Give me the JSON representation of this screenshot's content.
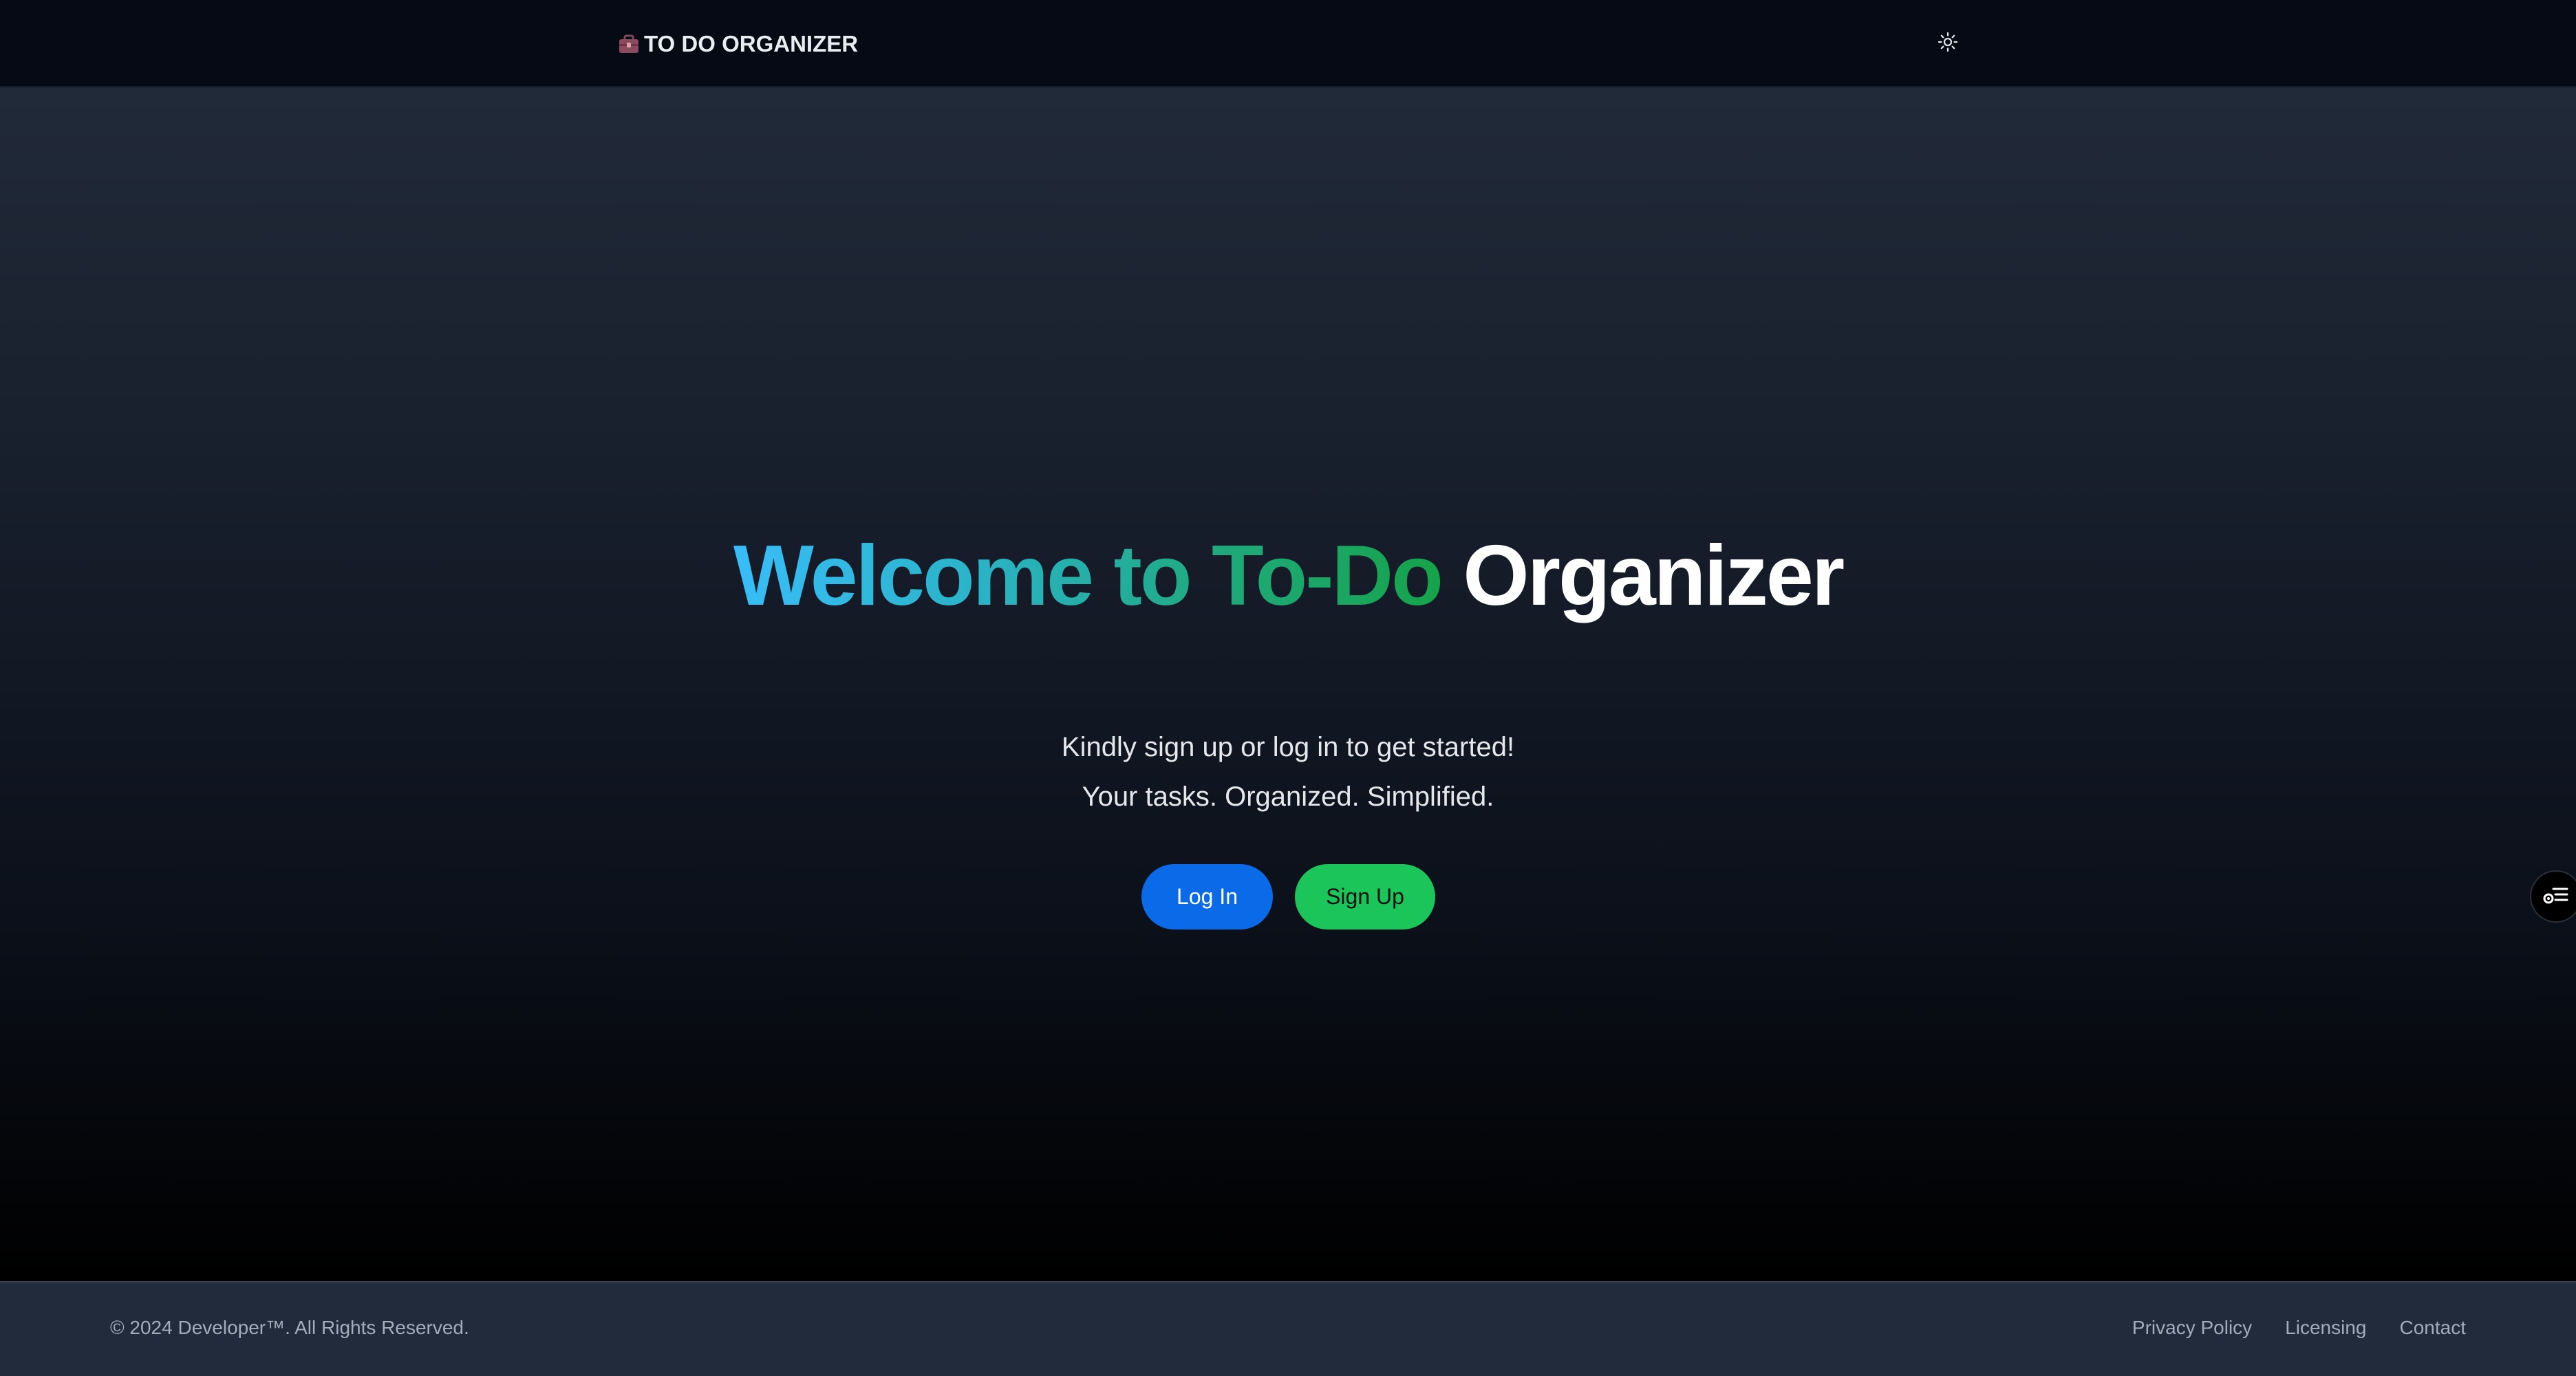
{
  "navbar": {
    "brand_text": "TO DO ORGANIZER",
    "brand_icon": "briefcase-icon",
    "theme_toggle_icon": "sun-icon"
  },
  "hero": {
    "title_gradient": "Welcome to To-Do",
    "title_plain": "Organizer",
    "subtitle_line1": "Kindly sign up or log in to get started!",
    "subtitle_line2": "Your tasks. Organized. Simplified.",
    "login_label": "Log In",
    "signup_label": "Sign Up"
  },
  "side_widget": {
    "icon": "settings-list-icon"
  },
  "footer": {
    "copyright": "© 2024 Developer™. All Rights Reserved.",
    "links": [
      "Privacy Policy",
      "Licensing",
      "Contact"
    ]
  },
  "colors": {
    "navbar_bg": "#050a14",
    "login_button": "#0a6ae8",
    "signup_button": "#1bc55a",
    "gradient_start": "#38bdf8",
    "gradient_end": "#15a34a",
    "footer_bg": "#222b3b"
  }
}
